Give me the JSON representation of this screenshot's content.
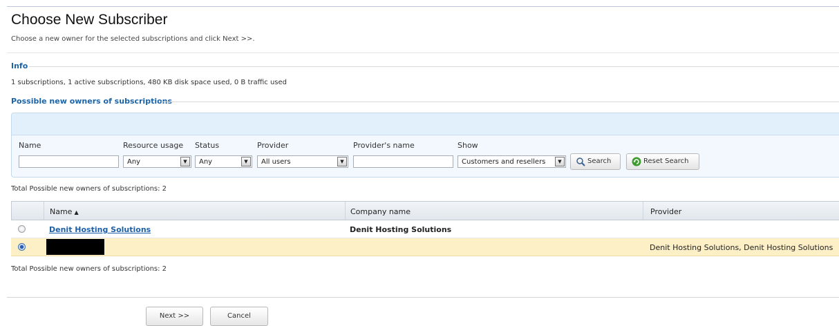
{
  "page": {
    "title": "Choose New Subscriber",
    "subtitle": "Choose a new owner for the selected subscriptions and click Next >>."
  },
  "info": {
    "heading": "Info",
    "summary": "1 subscriptions, 1 active subscriptions, 480 KB disk space used, 0 B traffic used"
  },
  "owners_section": {
    "heading": "Possible new owners of subscriptions"
  },
  "filters": {
    "name": {
      "label": "Name",
      "value": ""
    },
    "resource_usage": {
      "label": "Resource usage",
      "selected": "Any"
    },
    "status": {
      "label": "Status",
      "selected": "Any"
    },
    "provider": {
      "label": "Provider",
      "selected": "All users"
    },
    "providers_name": {
      "label": "Provider's name",
      "value": ""
    },
    "show": {
      "label": "Show",
      "selected": "Customers and resellers"
    },
    "search_button": "Search",
    "reset_button": "Reset Search"
  },
  "total_top": "Total Possible new owners of subscriptions: 2",
  "total_bottom": "Total Possible new owners of subscriptions: 2",
  "table": {
    "columns": [
      "Name",
      "Company name",
      "Provider"
    ],
    "sort_indicator": "▲",
    "rows": [
      {
        "name": "Denit Hosting Solutions",
        "company": "Denit Hosting Solutions",
        "provider": "",
        "selected": false
      },
      {
        "name": "",
        "company": "",
        "provider": "Denit Hosting Solutions, Denit Hosting Solutions",
        "selected": true
      }
    ]
  },
  "buttons": {
    "next": "Next >>",
    "cancel": "Cancel"
  },
  "icons": {
    "search": "magnifier-icon",
    "reset": "refresh-icon",
    "dropdown": "dropdown-arrow-icon"
  },
  "colors": {
    "accent": "#1c64a8",
    "selected_row": "#fdefc6",
    "filter_bg": "#f2f8fd"
  }
}
